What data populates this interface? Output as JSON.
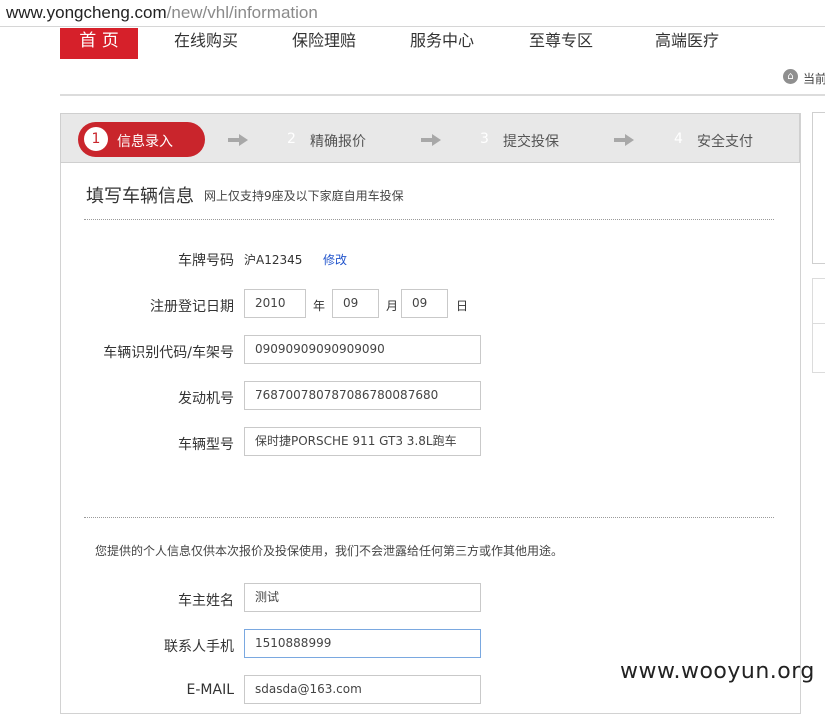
{
  "browser": {
    "url_host": "www.yongcheng.com",
    "url_path": "/new/vhl/information"
  },
  "nav": {
    "items": [
      "首 页",
      "在线购买",
      "保险理赔",
      "服务中心",
      "至尊专区",
      "高端医疗"
    ],
    "breadcrumb": "当前"
  },
  "steps": [
    {
      "num": "1",
      "label": "信息录入"
    },
    {
      "num": "2",
      "label": "精确报价"
    },
    {
      "num": "3",
      "label": "提交投保"
    },
    {
      "num": "4",
      "label": "安全支付"
    }
  ],
  "form": {
    "title": "填写车辆信息",
    "subtitle": "网上仅支持9座及以下家庭自用车投保",
    "plate_label": "车牌号码",
    "plate_value": "沪A12345",
    "modify_link": "修改",
    "reg_date_label": "注册登记日期",
    "reg_year": "2010",
    "year_unit": "年",
    "reg_month": "09",
    "month_unit": "月",
    "reg_day": "09",
    "day_unit": "日",
    "vin_label": "车辆识别代码/车架号",
    "vin_value": "09090909090909090",
    "engine_label": "发动机号",
    "engine_value": "768700780787086780087680",
    "model_label": "车辆型号",
    "model_value": "保时捷PORSCHE 911 GT3 3.8L跑车",
    "privacy_notice": "您提供的个人信息仅供本次报价及投保使用，我们不会泄露给任何第三方或作其他用途。",
    "owner_label": "车主姓名",
    "owner_value": "测试",
    "phone_label": "联系人手机",
    "phone_value": "1510888999",
    "email_label": "E-MAIL",
    "email_value": "sdasda@163.com"
  },
  "watermark": "www.wooyun.org",
  "colors": {
    "brand_red": "#d6202a",
    "step_red": "#c9252c",
    "link_blue": "#2255cc",
    "focus_border": "#7aa8e0"
  }
}
